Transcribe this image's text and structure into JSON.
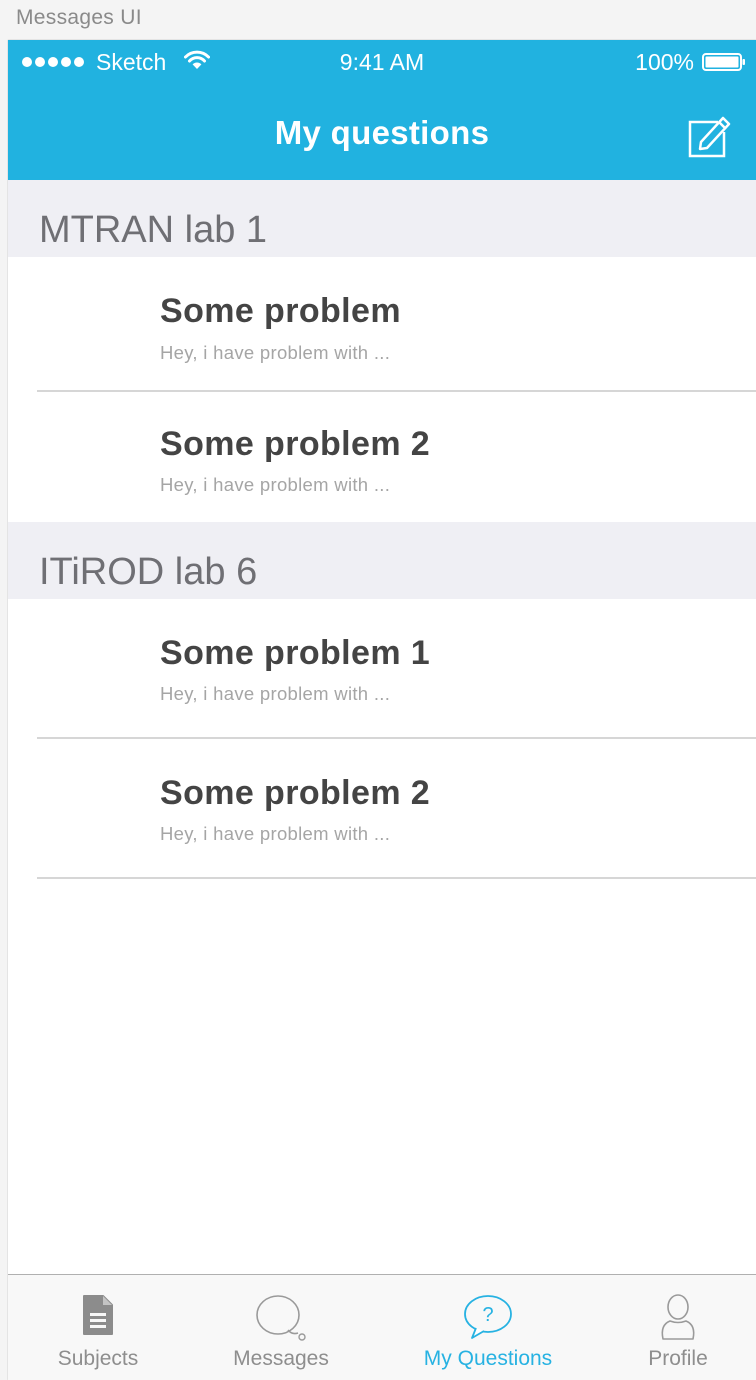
{
  "artboard": {
    "label": "Messages UI"
  },
  "status_bar": {
    "carrier": "Sketch",
    "time": "9:41 AM",
    "battery": "100%"
  },
  "nav": {
    "title": "My questions",
    "compose_icon": "compose-icon",
    "color": "#21b2e0"
  },
  "sections": [
    {
      "title": "MTRAN lab 1",
      "items": [
        {
          "title": "Some problem",
          "preview": "Hey, i have problem with ..."
        },
        {
          "title": "Some problem 2",
          "preview": "Hey, i have problem with ..."
        }
      ]
    },
    {
      "title": "ITiROD lab 6",
      "items": [
        {
          "title": "Some problem 1",
          "preview": "Hey, i have problem with ..."
        },
        {
          "title": "Some problem 2",
          "preview": "Hey, i have problem with ..."
        }
      ]
    }
  ],
  "tabbar": {
    "active": "My Questions",
    "active_color": "#27b2e2",
    "tabs": [
      {
        "label": "Subjects",
        "icon": "document-icon"
      },
      {
        "label": "Messages",
        "icon": "chat-bubble-icon"
      },
      {
        "label": "My Questions",
        "icon": "question-bubble-icon"
      },
      {
        "label": "Profile",
        "icon": "person-icon"
      }
    ]
  }
}
